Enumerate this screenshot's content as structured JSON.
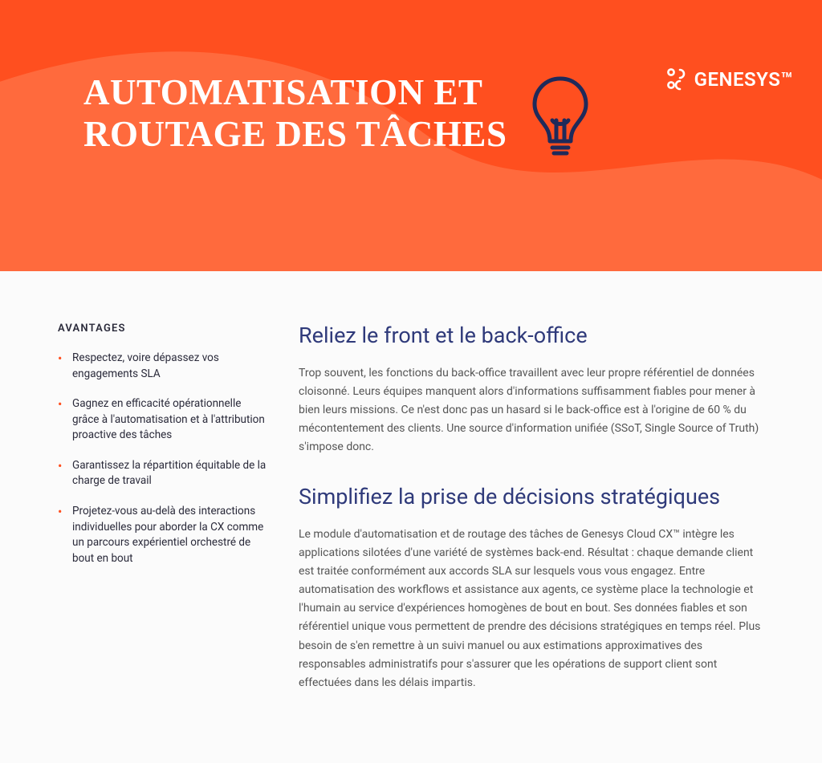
{
  "brand": {
    "name": "GENESYS™",
    "accent": "#ff4f1f",
    "heading_color": "#2f3a7a"
  },
  "hero": {
    "title": "AUTOMATISATION ET\nROUTAGE DES TÂCHES"
  },
  "sidebar": {
    "heading": "AVANTAGES",
    "benefits": [
      "Respectez, voire dépassez vos engagements SLA",
      "Gagnez en efficacité opérationnelle grâce à l'automatisation et à l'attribution proactive des tâches",
      "Garantissez la répartition équitable de la charge de travail",
      "Projetez-vous au-delà des interactions individuelles pour aborder la CX comme un parcours expérientiel orchestré de bout en bout"
    ]
  },
  "sections": [
    {
      "heading": "Reliez le front et le back-office",
      "body": "Trop souvent, les fonctions du back-office travaillent avec leur propre référentiel de données cloisonné. Leurs équipes manquent alors d'informations suffisamment fiables pour mener à bien leurs missions. Ce n'est donc pas un hasard si le back-office est à l'origine de 60 % du mécontentement des clients. Une source d'information unifiée (SSoT, Single Source of Truth) s'impose donc."
    },
    {
      "heading": "Simplifiez la prise de décisions stratégiques",
      "body": "Le module d'automatisation et de routage des tâches de Genesys Cloud CX™ intègre les applications silotées d'une variété de systèmes back-end. Résultat : chaque demande client est traitée conformément aux accords SLA sur lesquels vous vous engagez. Entre automatisation des workflows et assistance aux agents, ce système place la technologie et l'humain au service d'expériences homogènes de bout en bout. Ses données fiables et son référentiel unique vous permettent de prendre des décisions stratégiques en temps réel. Plus besoin de s'en remettre à un suivi manuel ou aux estimations approximatives des responsables administratifs pour s'assurer que les opérations de support client sont effectuées dans les délais impartis."
    }
  ]
}
